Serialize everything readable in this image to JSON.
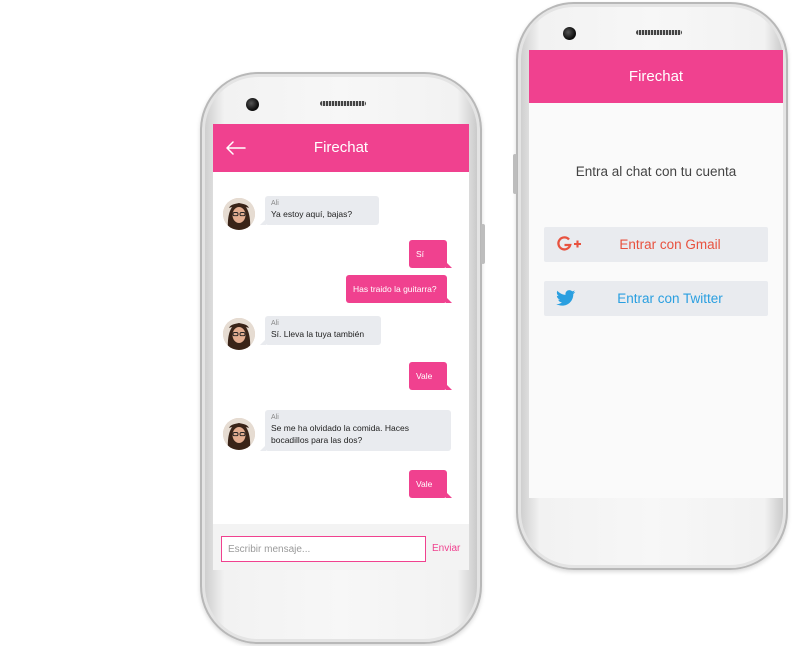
{
  "colors": {
    "accent": "#f0418f",
    "bubble_in": "#e9ebef",
    "gmail": "#e8523f",
    "twitter": "#2a9fe0"
  },
  "chat_screen": {
    "title": "Firechat",
    "back_icon": "arrow-left-icon",
    "messages": [
      {
        "direction": "in",
        "sender": "Ali",
        "text": "Ya estoy aquí, bajas?"
      },
      {
        "direction": "out",
        "text": "Sí"
      },
      {
        "direction": "out",
        "text": "Has traido la guitarra?"
      },
      {
        "direction": "in",
        "sender": "Ali",
        "text": "Sí. Lleva la tuya también"
      },
      {
        "direction": "out",
        "text": "Vale"
      },
      {
        "direction": "in",
        "sender": "Ali",
        "text": "Se me ha olvidado la comida. Haces bocadillos para las dos?"
      },
      {
        "direction": "out",
        "text": "Vale"
      }
    ],
    "input_placeholder": "Escribir mensaje...",
    "send_label": "Enviar"
  },
  "login_screen": {
    "title": "Firechat",
    "prompt": "Entra al chat con tu cuenta",
    "gmail_label": "Entrar con Gmail",
    "gmail_icon": "google-plus-icon",
    "twitter_label": "Entrar con Twitter",
    "twitter_icon": "twitter-bird-icon"
  }
}
